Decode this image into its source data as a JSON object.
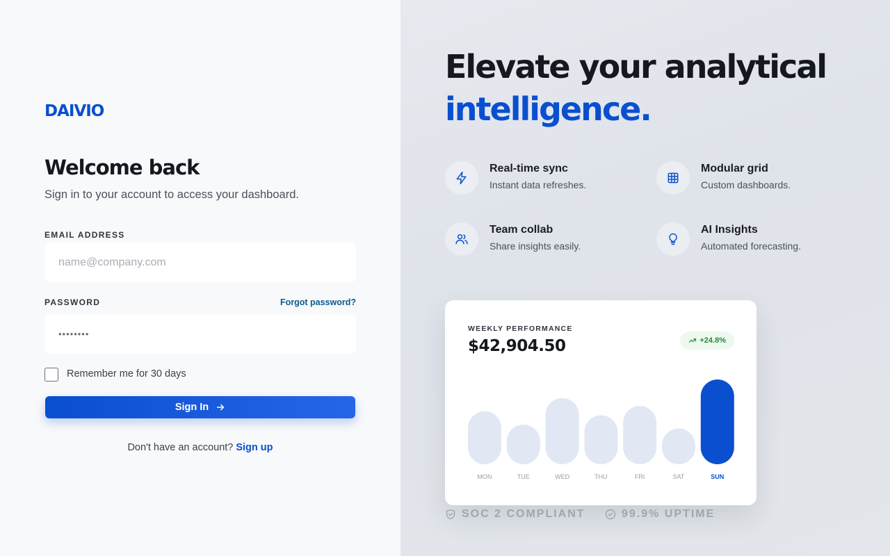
{
  "brand": {
    "logo_text": "DAIVIO",
    "accent_color": "#0a4fcf"
  },
  "login": {
    "title": "Welcome back",
    "subtitle": "Sign in to your account to access your dashboard.",
    "email_label": "EMAIL ADDRESS",
    "email_placeholder": "name@company.com",
    "password_label": "PASSWORD",
    "password_value": "••••••••",
    "forgot_link": "Forgot password?",
    "remember_label": "Remember me for 30 days",
    "remember_checked": false,
    "signin_button": "Sign In",
    "signup_prompt": "Don't have an account?",
    "signup_link": "Sign up"
  },
  "hero": {
    "headline_line1": "Elevate your analytical",
    "headline_line2": "intelligence."
  },
  "features": [
    {
      "icon": "lightning-icon",
      "title": "Real-time sync",
      "desc": "Instant data refreshes."
    },
    {
      "icon": "grid-icon",
      "title": "Modular grid",
      "desc": "Custom dashboards."
    },
    {
      "icon": "users-icon",
      "title": "Team collab",
      "desc": "Share insights easily."
    },
    {
      "icon": "lightbulb-icon",
      "title": "AI Insights",
      "desc": "Automated forecasting."
    }
  ],
  "perf_card": {
    "title": "WEEKLY PERFORMANCE",
    "value": "$42,904.50",
    "change": "+24.8%",
    "change_color": "#1f8f3a"
  },
  "chart_data": {
    "type": "bar",
    "categories": [
      "MON",
      "TUE",
      "WED",
      "THU",
      "FRI",
      "SAT",
      "SUN"
    ],
    "values": [
      40,
      30,
      50,
      37,
      44,
      27,
      64
    ],
    "highlight": "SUN",
    "bar_color": "#e1e8f4",
    "highlight_color": "#0a4fcf",
    "ylim": [
      0,
      64
    ]
  },
  "trust": {
    "soc": "SOC 2 COMPLIANT",
    "uptime": "99.9% UPTIME"
  }
}
